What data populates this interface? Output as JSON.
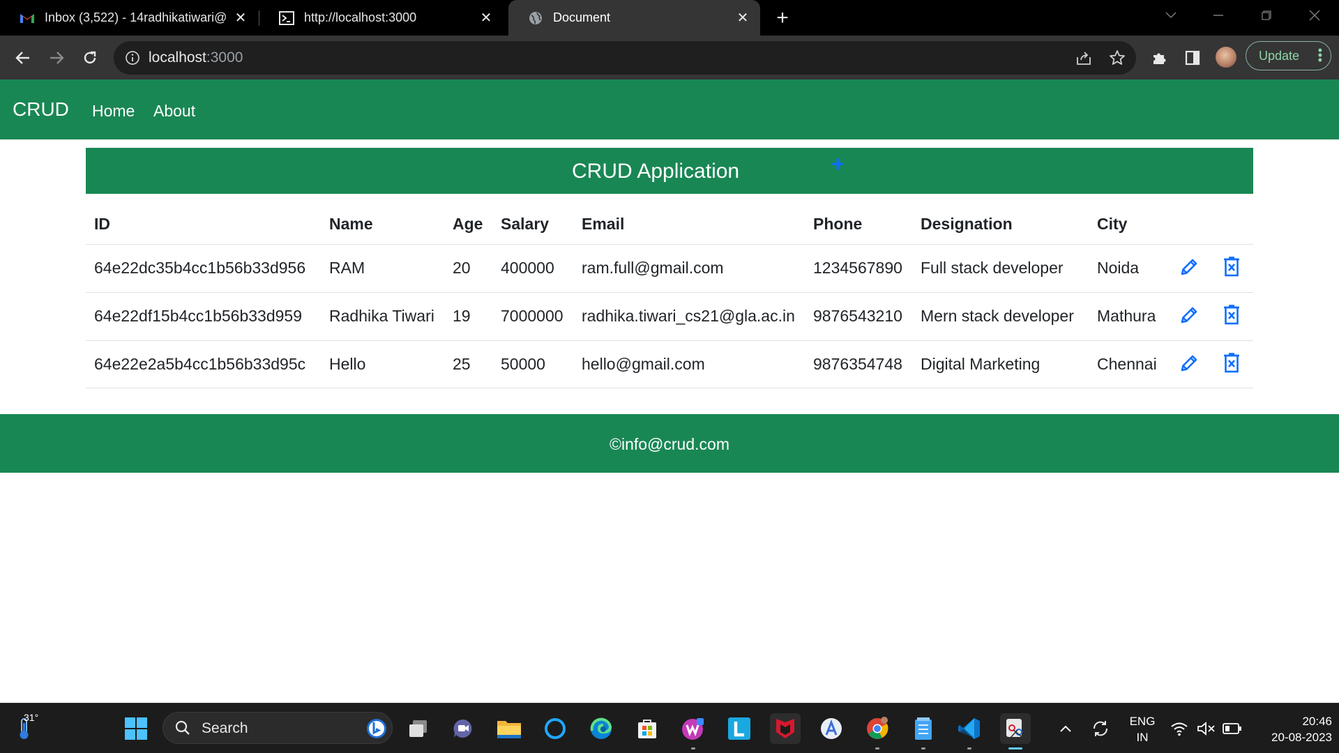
{
  "browser": {
    "tabs": [
      {
        "title": "Inbox (3,522) - 14radhikatiwari@",
        "active": false
      },
      {
        "title": "http://localhost:3000",
        "active": false
      },
      {
        "title": "Document",
        "active": true
      }
    ],
    "address_host": "localhost",
    "address_port": ":3000",
    "update_label": "Update"
  },
  "navbar": {
    "brand": "CRUD",
    "links": [
      "Home",
      "About"
    ]
  },
  "app": {
    "title": "CRUD Application",
    "add_symbol": "+"
  },
  "table": {
    "headers": [
      "ID",
      "Name",
      "Age",
      "Salary",
      "Email",
      "Phone",
      "Designation",
      "City"
    ],
    "rows": [
      [
        "64e22dc35b4cc1b56b33d956",
        "RAM",
        "20",
        "400000",
        "ram.full@gmail.com",
        "1234567890",
        "Full stack developer",
        "Noida"
      ],
      [
        "64e22df15b4cc1b56b33d959",
        "Radhika Tiwari",
        "19",
        "7000000",
        "radhika.tiwari_cs21@gla.ac.in",
        "9876543210",
        "Mern stack developer",
        "Mathura"
      ],
      [
        "64e22e2a5b4cc1b56b33d95c",
        "Hello",
        "25",
        "50000",
        "hello@gmail.com",
        "9876354748",
        "Digital Marketing",
        "Chennai"
      ]
    ]
  },
  "footer": {
    "text": "©info@crud.com"
  },
  "taskbar": {
    "weather_temp": "31°",
    "search_label": "Search",
    "language_line1": "ENG",
    "language_line2": "IN",
    "time": "20:46",
    "date": "20-08-2023"
  },
  "colors": {
    "primary_green": "#198754",
    "action_blue": "#0d6efd"
  }
}
